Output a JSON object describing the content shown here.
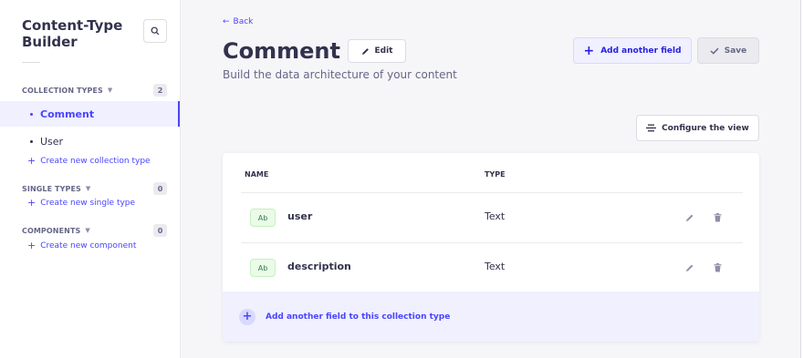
{
  "sidebar": {
    "title": "Content-Type Builder",
    "sections": [
      {
        "label": "COLLECTION TYPES",
        "count": "2",
        "items": [
          "Comment",
          "User"
        ],
        "create_label": "Create new collection type"
      },
      {
        "label": "SINGLE TYPES",
        "count": "0",
        "items": [],
        "create_label": "Create new single type"
      },
      {
        "label": "COMPONENTS",
        "count": "0",
        "items": [],
        "create_label": "Create new component"
      }
    ],
    "active_item": "Comment"
  },
  "header": {
    "back_label": "Back",
    "title": "Comment",
    "edit_label": "Edit",
    "subtitle": "Build the data architecture of your content",
    "add_field_label": "Add another field",
    "save_label": "Save",
    "configure_label": "Configure the view"
  },
  "table": {
    "columns": [
      "NAME",
      "TYPE"
    ],
    "rows": [
      {
        "badge": "Ab",
        "name": "user",
        "type": "Text"
      },
      {
        "badge": "Ab",
        "name": "description",
        "type": "Text"
      }
    ],
    "add_footer_label": "Add another field to this collection type"
  },
  "icons": {
    "search": "search-icon",
    "back": "arrow-left-icon",
    "edit": "pencil-icon",
    "add": "plus-icon",
    "save": "check-icon",
    "configure": "layout-lines-icon",
    "delete": "trash-icon",
    "chevron": "chevron-down-icon"
  },
  "colors": {
    "primary": "#4945ff",
    "active_bg": "#f0f0ff",
    "badge_bg": "#eafbe7",
    "badge_text": "#328048",
    "text_dark": "#32324d",
    "text_muted": "#666687"
  }
}
